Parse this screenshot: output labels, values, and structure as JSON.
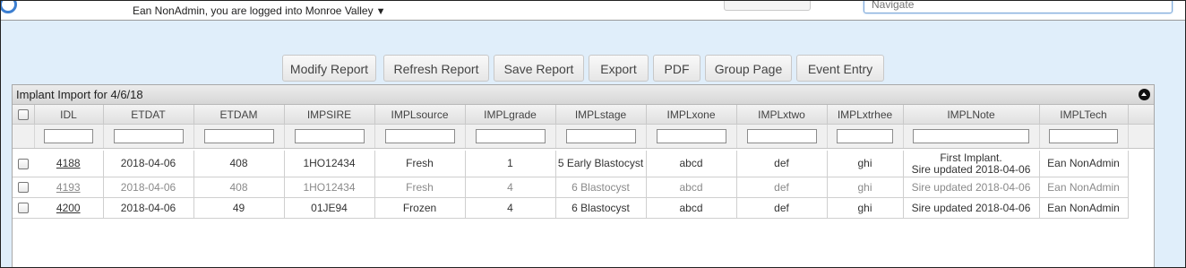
{
  "topbar": {
    "user_text": "Ean NonAdmin, you are logged into Monroe Valley",
    "user_caret": "▼",
    "navigate_placeholder": "Navigate"
  },
  "toolbar": {
    "buttons": [
      "Modify Report",
      "Refresh Report",
      "Save Report",
      "Export",
      "PDF",
      "Group Page",
      "Event Entry"
    ]
  },
  "panel": {
    "title": "Implant Import for 4/6/18"
  },
  "table": {
    "columns": [
      "IDL",
      "ETDAT",
      "ETDAM",
      "IMPSIRE",
      "IMPLsource",
      "IMPLgrade",
      "IMPLstage",
      "IMPLxone",
      "IMPLxtwo",
      "IMPLxtrhee",
      "IMPLNote",
      "IMPLTech"
    ],
    "rows": [
      {
        "idl": "4188",
        "etdat": "2018-04-06",
        "etdam": "408",
        "impsire": "1HO12434",
        "source": "Fresh",
        "grade": "1",
        "stage": "5 Early Blastocyst",
        "xone": "abcd",
        "xtwo": "def",
        "xthree": "ghi",
        "note1": "First Implant.",
        "note2": "Sire updated 2018-04-06",
        "tech": "Ean NonAdmin"
      },
      {
        "idl": "4193",
        "etdat": "2018-04-06",
        "etdam": "408",
        "impsire": "1HO12434",
        "source": "Fresh",
        "grade": "4",
        "stage": "6 Blastocyst",
        "xone": "abcd",
        "xtwo": "def",
        "xthree": "ghi",
        "note1": "Sire updated 2018-04-06",
        "tech": "Ean NonAdmin"
      },
      {
        "idl": "4200",
        "etdat": "2018-04-06",
        "etdam": "49",
        "impsire": "01JE94",
        "source": "Frozen",
        "grade": "4",
        "stage": "6 Blastocyst",
        "xone": "abcd",
        "xtwo": "def",
        "xthree": "ghi",
        "note1": "Sire updated 2018-04-06",
        "tech": "Ean NonAdmin"
      }
    ]
  },
  "colors": {
    "page_bg": "#e0eefa",
    "header_bg": "#e6e6e6",
    "link": "#333333"
  }
}
